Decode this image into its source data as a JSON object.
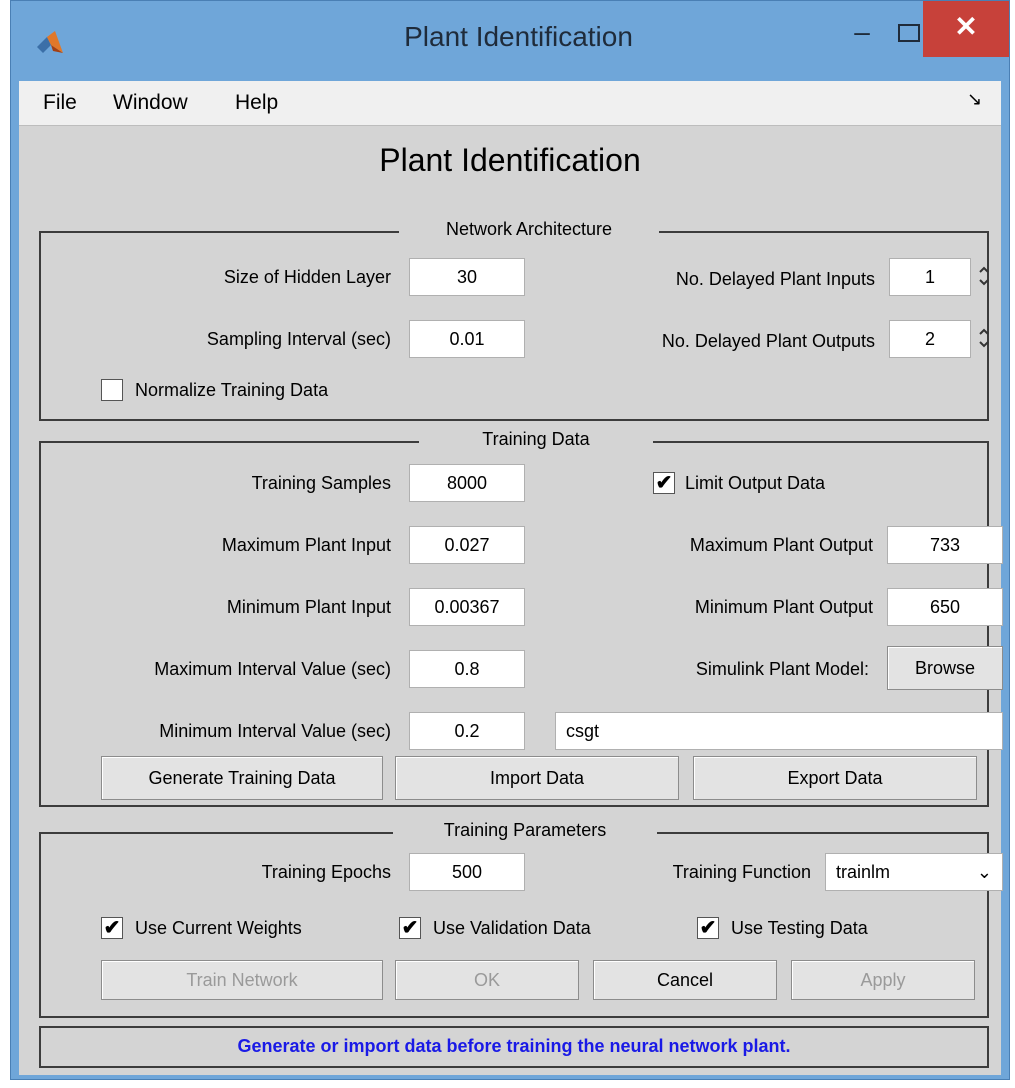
{
  "window": {
    "title": "Plant Identification",
    "minimize_glyph": "–",
    "close_glyph": "✕",
    "icon": "matlab-icon"
  },
  "menu": {
    "items": [
      "File",
      "Window",
      "Help"
    ],
    "dock_glyph": "↘"
  },
  "page_title": "Plant Identification",
  "network_architecture": {
    "legend": "Network Architecture",
    "hidden_layer_label": "Size of Hidden Layer",
    "hidden_layer_value": "30",
    "sampling_label": "Sampling Interval (sec)",
    "sampling_value": "0.01",
    "delayed_inputs_label": "No. Delayed Plant Inputs",
    "delayed_inputs_value": "1",
    "delayed_outputs_label": "No. Delayed Plant Outputs",
    "delayed_outputs_value": "2",
    "normalize_label": "Normalize Training Data",
    "normalize_checked": false
  },
  "training_data": {
    "legend": "Training Data",
    "samples_label": "Training Samples",
    "samples_value": "8000",
    "limit_output_label": "Limit Output Data",
    "limit_output_checked": true,
    "max_input_label": "Maximum Plant Input",
    "max_input_value": "0.027",
    "max_output_label": "Maximum Plant Output",
    "max_output_value": "733",
    "min_input_label": "Minimum Plant Input",
    "min_input_value": "0.00367",
    "min_output_label": "Minimum Plant Output",
    "min_output_value": "650",
    "max_interval_label": "Maximum Interval Value (sec)",
    "max_interval_value": "0.8",
    "simulink_label": "Simulink Plant Model:",
    "browse_label": "Browse",
    "min_interval_label": "Minimum Interval Value (sec)",
    "min_interval_value": "0.2",
    "model_name": "csgt",
    "generate_label": "Generate Training Data",
    "import_label": "Import Data",
    "export_label": "Export Data"
  },
  "training_parameters": {
    "legend": "Training Parameters",
    "epochs_label": "Training Epochs",
    "epochs_value": "500",
    "function_label": "Training Function",
    "function_value": "trainlm",
    "use_weights_label": "Use Current Weights",
    "use_validation_label": "Use Validation Data",
    "use_testing_label": "Use Testing Data",
    "train_label": "Train Network",
    "ok_label": "OK",
    "cancel_label": "Cancel",
    "apply_label": "Apply"
  },
  "status": "Generate or import data before training the neural network plant.",
  "colors": {
    "titlebar": "#6fa6d9",
    "close_button": "#c7413a",
    "panel_bg": "#d4d4d4",
    "status_text": "#1a1ae6"
  }
}
